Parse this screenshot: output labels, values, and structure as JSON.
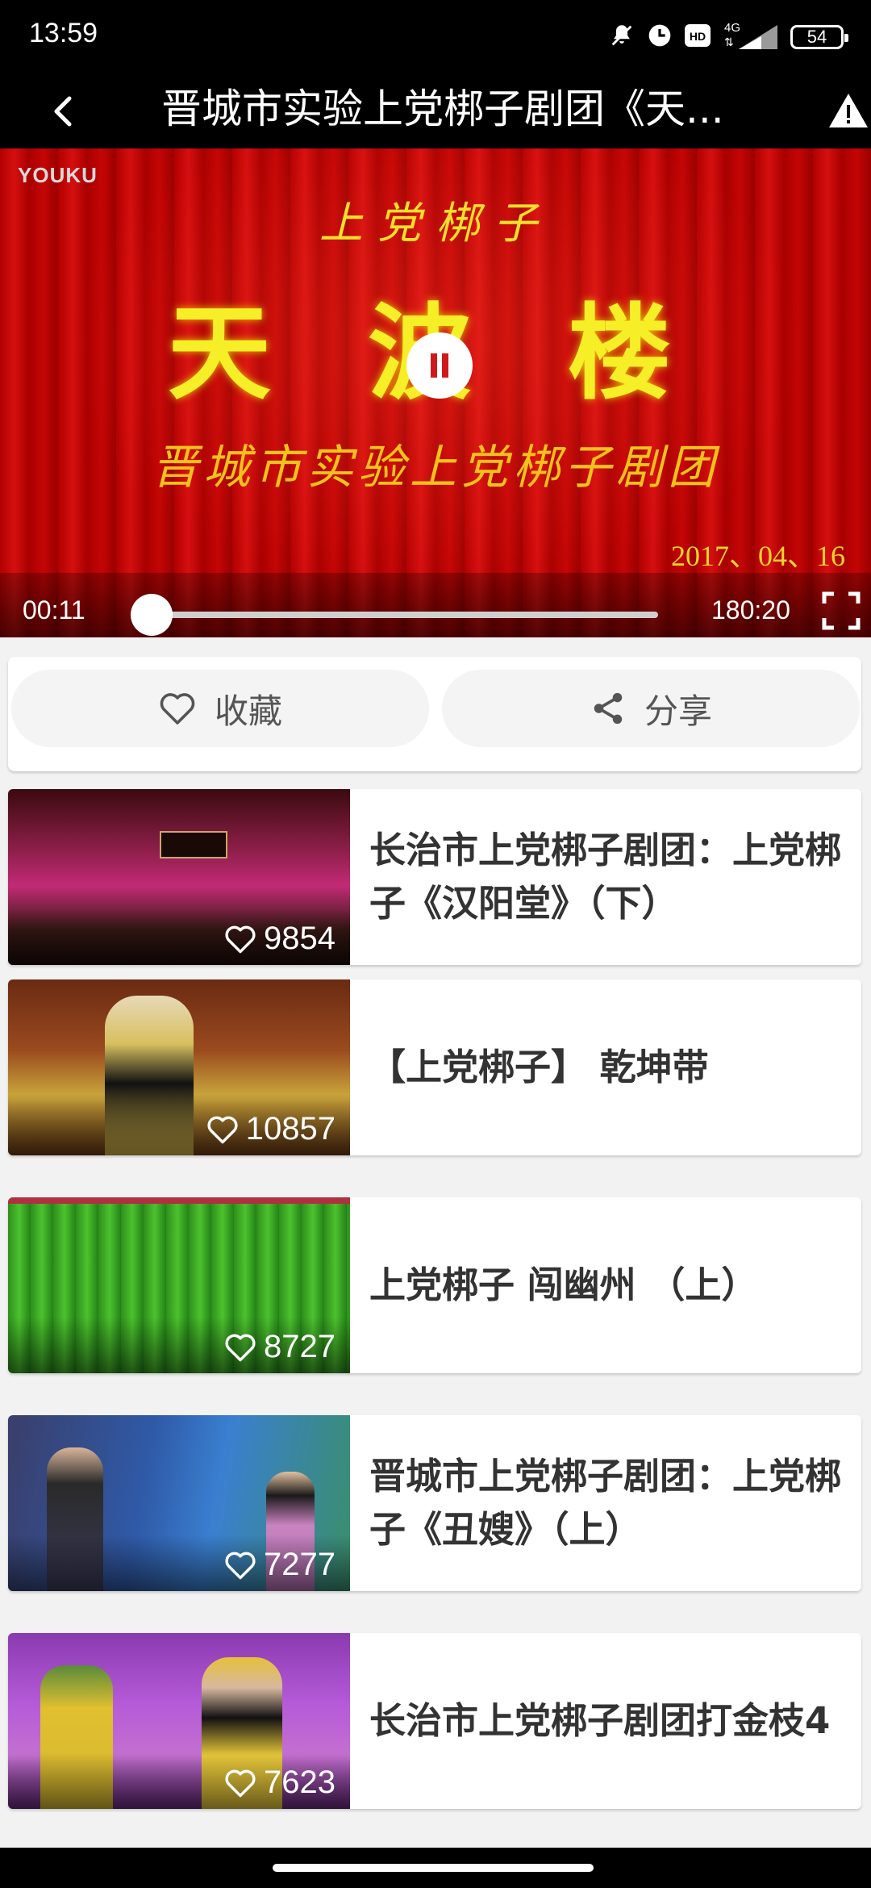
{
  "status_bar": {
    "time": "13:59",
    "network": "4G",
    "hd": "HD",
    "battery": "54"
  },
  "app_bar": {
    "title": "晋城市实验上党梆子剧团《天..."
  },
  "player": {
    "watermark": "YOUKU",
    "overlay_line1": "上党梆子",
    "overlay_line2": "天波楼",
    "overlay_line3": "晋城市实验上党梆子剧团",
    "overlay_date": "2017、04、16",
    "current_time": "00:11",
    "duration": "180:20",
    "progress_fraction": 0.0
  },
  "actions": {
    "favorite_label": "收藏",
    "share_label": "分享"
  },
  "list": [
    {
      "title": "长治市上党梆子剧团：上党梆子《汉阳堂》（下）",
      "likes": "9854"
    },
    {
      "title": "【上党梆子】 乾坤带",
      "likes": "10857"
    },
    {
      "title": "上党梆子 闯幽州 （上）",
      "likes": "8727"
    },
    {
      "title": "晋城市上党梆子剧团：上党梆子《丑嫂》（上）",
      "likes": "7277"
    },
    {
      "title": "长治市上党梆子剧团打金枝4",
      "likes": "7623"
    }
  ],
  "colors": {
    "background": "#f2f2f2",
    "bar": "#000000",
    "curtain_red": "#c40505",
    "accent_text": "#333333"
  }
}
